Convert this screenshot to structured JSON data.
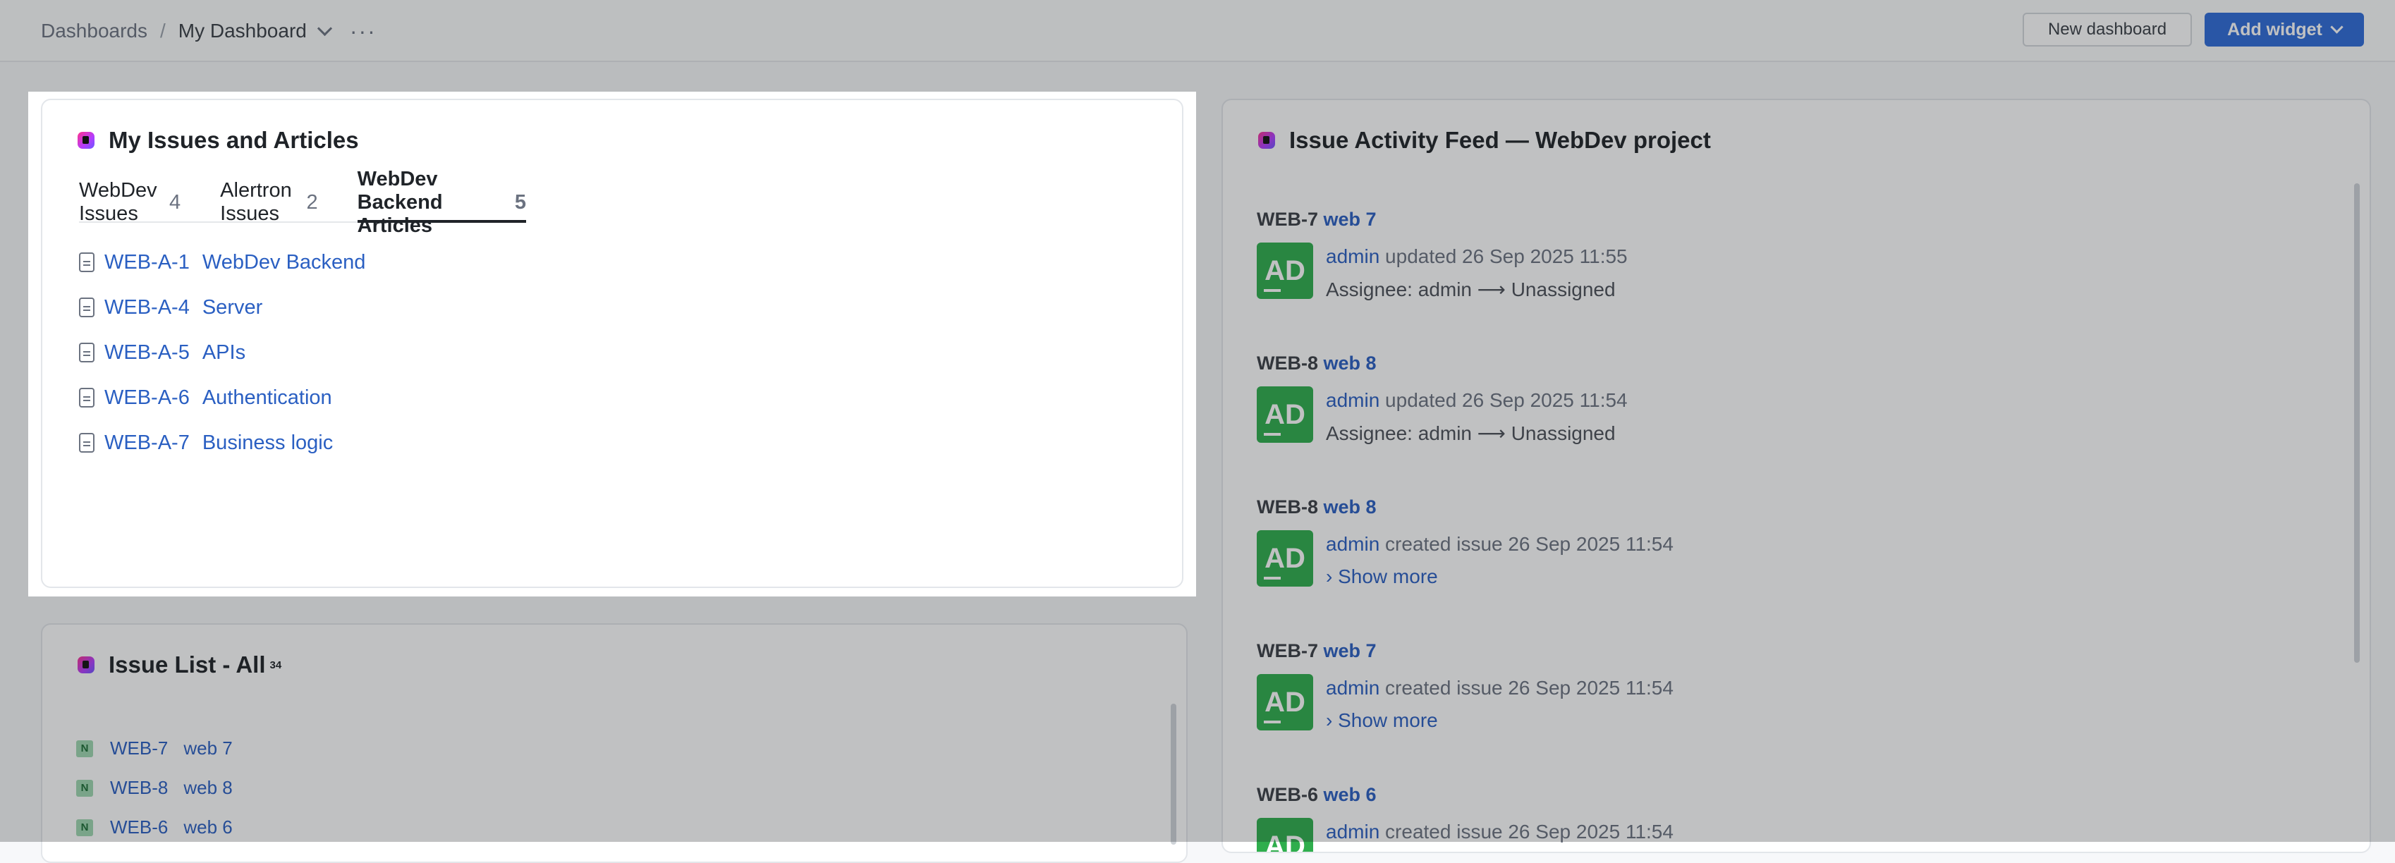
{
  "topbar": {
    "breadcrumb_root": "Dashboards",
    "breadcrumb_sep": "/",
    "breadcrumb_current": "My Dashboard",
    "more": "···",
    "new_dashboard_label": "New dashboard",
    "add_widget_label": "Add widget"
  },
  "issues_widget": {
    "title": "My Issues and Articles",
    "tabs": [
      {
        "label": "WebDev Issues",
        "count": "4"
      },
      {
        "label": "Alertron Issues",
        "count": "2"
      },
      {
        "label": "WebDev Backend Articles",
        "count": "5",
        "active": true
      }
    ],
    "articles": [
      {
        "id": "WEB-A-1",
        "title": "WebDev Backend"
      },
      {
        "id": "WEB-A-4",
        "title": "Server"
      },
      {
        "id": "WEB-A-5",
        "title": "APIs"
      },
      {
        "id": "WEB-A-6",
        "title": "Authentication"
      },
      {
        "id": "WEB-A-7",
        "title": "Business logic"
      }
    ]
  },
  "activity_feed": {
    "title": "Issue Activity Feed — WebDev project",
    "entries": [
      {
        "issue": "WEB-7",
        "name": "web 7",
        "avatar": "AD",
        "user": "admin",
        "action": "updated 26 Sep 2025 11:55",
        "detail": "Assignee:  admin ⟶ Unassigned"
      },
      {
        "issue": "WEB-8",
        "name": "web 8",
        "avatar": "AD",
        "user": "admin",
        "action": "updated 26 Sep 2025 11:54",
        "detail": "Assignee:  admin ⟶ Unassigned"
      },
      {
        "issue": "WEB-8",
        "name": "web 8",
        "avatar": "AD",
        "user": "admin",
        "action": "created issue 26 Sep 2025 11:54",
        "detail": "›  Show more"
      },
      {
        "issue": "WEB-7",
        "name": "web 7",
        "avatar": "AD",
        "user": "admin",
        "action": "created issue 26 Sep 2025 11:54",
        "detail": "›  Show more"
      },
      {
        "issue": "WEB-6",
        "name": "web 6",
        "avatar": "AD",
        "user": "admin",
        "action": "created issue 26 Sep 2025 11:54",
        "detail": ""
      }
    ]
  },
  "issue_list": {
    "title": "Issue List - All",
    "count": "34",
    "issues": [
      {
        "badge": "N",
        "id": "WEB-7",
        "title": "web 7"
      },
      {
        "badge": "N",
        "id": "WEB-8",
        "title": "web 8"
      },
      {
        "badge": "N",
        "id": "WEB-6",
        "title": "web 6"
      }
    ]
  },
  "colors": {
    "accent": "#2f6bd8",
    "link": "#2a5fc2",
    "avatar": "#2fae4d"
  }
}
